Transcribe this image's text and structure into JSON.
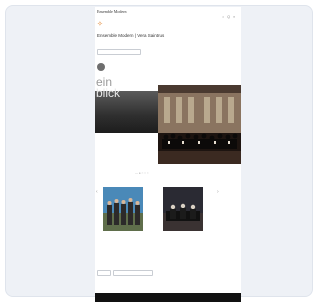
{
  "brand": {
    "name": "Ensemble Modern",
    "tagline": "",
    "emblem": "✧"
  },
  "header": {
    "tools": [
      "○",
      "Q",
      "≡"
    ]
  },
  "page": {
    "heading": "Ensemble Modern | Vera Saintrus"
  },
  "filters": {
    "top_chip": "",
    "bottom_chips": [
      "",
      ""
    ]
  },
  "hero": {
    "word1": "ein",
    "word2": "blick"
  },
  "carousel": {
    "dots": "— ● ○ ○ ○",
    "arrow_left": "‹",
    "arrow_right": "›"
  },
  "events": [
    {
      "line1": "",
      "line2": ""
    },
    {
      "line1": "",
      "line2": ""
    },
    {
      "line1": "",
      "line2": ""
    }
  ],
  "footer": {
    "label": ""
  },
  "colors": {
    "accent": "#e0822c",
    "dark": "#111111",
    "card_bg": "#eef1f6"
  }
}
